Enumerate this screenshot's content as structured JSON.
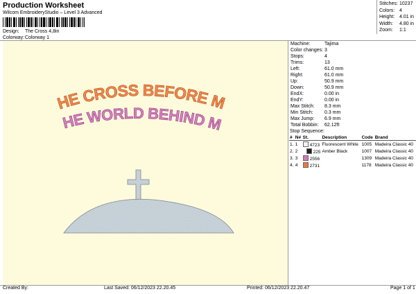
{
  "header": {
    "title": "Production Worksheet",
    "software": "Wilcom EmbroideryStudio – Level 3 Advanced",
    "design_label": "Design:",
    "design_value": "The Cross 4,8in",
    "colorway_label": "Colorway:",
    "colorway_value": "Colorway 1"
  },
  "summary": [
    {
      "label": "Stitches:",
      "value": "10237"
    },
    {
      "label": "Colors:",
      "value": "4"
    },
    {
      "label": "Height:",
      "value": "4.01 in"
    },
    {
      "label": "Width:",
      "value": "4.80 in"
    },
    {
      "label": "Zoom:",
      "value": "1:1"
    }
  ],
  "details": [
    {
      "label": "Machine:",
      "value": "Tajima"
    },
    {
      "label": "Color changes:",
      "value": "3"
    },
    {
      "label": "Stops:",
      "value": "4"
    },
    {
      "label": "Trims:",
      "value": "13"
    },
    {
      "label": "Left:",
      "value": "61.0 mm"
    },
    {
      "label": "Right:",
      "value": "61.0 mm"
    },
    {
      "label": "Up:",
      "value": "50.9 mm"
    },
    {
      "label": "Down:",
      "value": "50.9 mm"
    },
    {
      "label": "EndX:",
      "value": "0.00 in"
    },
    {
      "label": "EndY:",
      "value": "0.00 in"
    },
    {
      "label": "Max Stitch:",
      "value": "8.3 mm"
    },
    {
      "label": "Min Stitch:",
      "value": "0.3 mm"
    },
    {
      "label": "Max Jump:",
      "value": "6.9 mm"
    },
    {
      "label": "Total Bobbin:",
      "value": "62.12ft"
    }
  ],
  "stop_sequence": {
    "title": "Stop Sequence:",
    "headers": [
      "#",
      "N#",
      "St.",
      "Description",
      "Code",
      "Brand"
    ],
    "rows": [
      {
        "num": "1.",
        "n": "1",
        "color": "#f4f4f6",
        "st": "4723",
        "desc": "Fluorescent White",
        "code": "1005",
        "brand": "Madeira Classic 40"
      },
      {
        "num": "2.",
        "n": "2",
        "color": "#202020",
        "st": "225",
        "desc": "Amber Black",
        "code": "1007",
        "brand": "Madeira Classic 40"
      },
      {
        "num": "3.",
        "n": "3",
        "color": "#d07ab6",
        "st": "2556",
        "desc": "",
        "code": "1309",
        "brand": "Madeira Classic 40"
      },
      {
        "num": "4.",
        "n": "4",
        "color": "#ee7a3c",
        "st": "2731",
        "desc": "",
        "code": "1178",
        "brand": "Madeira Classic 40"
      }
    ]
  },
  "design": {
    "line1": "THE CROSS BEFORE ME",
    "line2": "THE WORLD BEHIND ME",
    "line1_color": "#f2884a",
    "line2_color": "#d77fc2",
    "hill_color": "#c9d3da",
    "background": "#fdfbdc"
  },
  "footer": {
    "created_by": "Created By:",
    "last_saved": "Last Saved: 06/12/2023 22.20.45",
    "printed": "Printed: 06/12/2023 22.20.47",
    "page": "Page 1 of 1"
  }
}
